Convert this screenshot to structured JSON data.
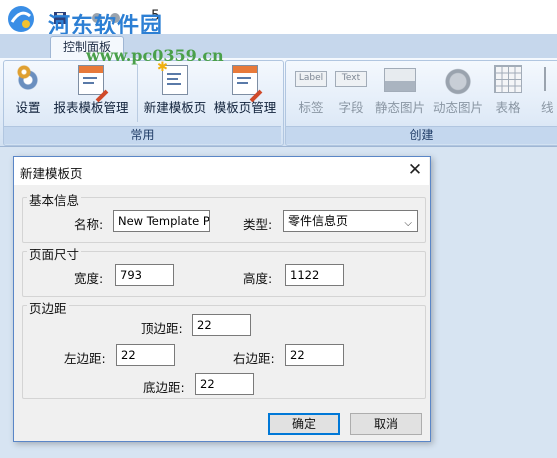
{
  "titlebar": {
    "app_title_fragment": "5",
    "watermark_text": "河东软件园",
    "watermark_url": "www.pc0359.cn"
  },
  "ribbon": {
    "active_tab": "控制面板",
    "groups": {
      "common": {
        "label": "常用",
        "buttons": [
          {
            "label": "设置",
            "icon": "settings-gear-icon"
          },
          {
            "label": "报表模板管理",
            "icon": "report-template-icon"
          },
          {
            "label": "新建模板页",
            "icon": "new-template-page-icon"
          },
          {
            "label": "模板页管理",
            "icon": "template-page-manage-icon"
          }
        ]
      },
      "create": {
        "label": "创建",
        "buttons": [
          {
            "label": "标签",
            "icon": "label-icon",
            "icon_text": "Label"
          },
          {
            "label": "字段",
            "icon": "text-field-icon",
            "icon_text": "Text"
          },
          {
            "label": "静态图片",
            "icon": "static-image-icon"
          },
          {
            "label": "动态图片",
            "icon": "dynamic-image-icon"
          },
          {
            "label": "表格",
            "icon": "table-grid-icon"
          },
          {
            "label": "线",
            "icon": "line-icon"
          }
        ]
      }
    }
  },
  "dialog": {
    "title": "新建模板页",
    "close_glyph": "✕",
    "basic": {
      "legend": "基本信息",
      "name_label": "名称:",
      "name_value": "New Template Page",
      "type_label": "类型:",
      "type_value": "零件信息页"
    },
    "page_size": {
      "legend": "页面尺寸",
      "width_label": "宽度:",
      "width_value": "793",
      "height_label": "高度:",
      "height_value": "1122"
    },
    "margins": {
      "legend": "页边距",
      "top_label": "顶边距:",
      "top_value": "22",
      "left_label": "左边距:",
      "left_value": "22",
      "right_label": "右边距:",
      "right_value": "22",
      "bottom_label": "底边距:",
      "bottom_value": "22"
    },
    "ok_label": "确定",
    "cancel_label": "取消"
  },
  "colors": {
    "ribbon_bg": "#dfeaf7",
    "dialog_border": "#5a86c7",
    "default_button_border": "#0078d7",
    "watermark_blue": "#2c7fd4",
    "watermark_green": "#4aa04a"
  }
}
